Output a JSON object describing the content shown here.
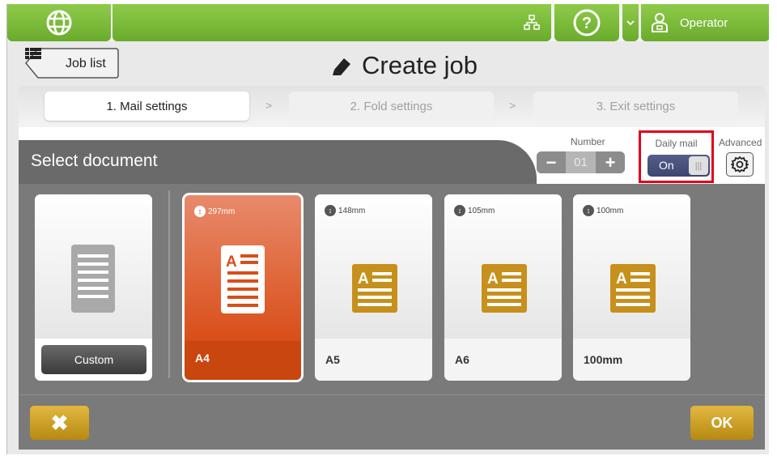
{
  "topbar": {
    "operator_label": "Operator",
    "globe_icon": "globe-icon",
    "network_icon": "network-icon",
    "help_icon": "help-icon",
    "dropdown_icon": "chevron-down-icon",
    "user_icon": "user-icon"
  },
  "header": {
    "back_label": "Job list",
    "title": "Create job"
  },
  "steps": [
    {
      "label": "1. Mail settings"
    },
    {
      "label": "2. Fold settings"
    },
    {
      "label": "3. Exit settings"
    }
  ],
  "panel": {
    "select_label": "Select document",
    "number_label": "Number",
    "number_value": "01",
    "daily_mail_label": "Daily mail",
    "daily_mail_state": "On",
    "advanced_label": "Advanced"
  },
  "documents": [
    {
      "name": "Custom"
    },
    {
      "name": "A4",
      "size": "297mm",
      "selected": true
    },
    {
      "name": "A5",
      "size": "148mm"
    },
    {
      "name": "A6",
      "size": "105mm"
    },
    {
      "name": "100mm",
      "size": "100mm"
    }
  ],
  "buttons": {
    "cancel_symbol": "✖",
    "ok_label": "OK"
  },
  "colors": {
    "accent_green": "#7bbd3a",
    "selected_orange": "#d94e18",
    "doc_gold": "#c7901c",
    "highlight_red": "#e0001b"
  }
}
